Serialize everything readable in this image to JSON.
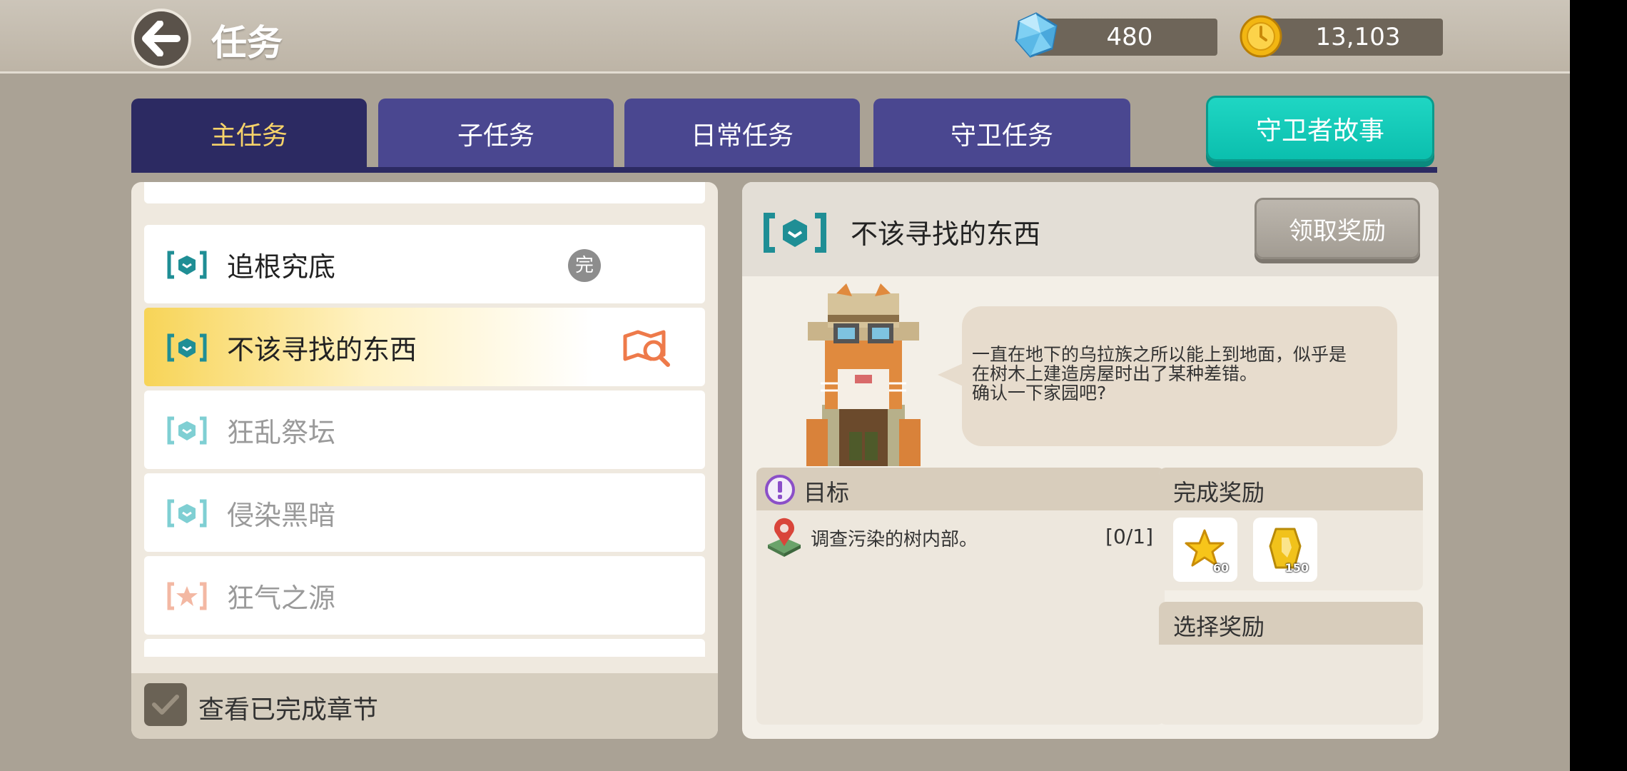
{
  "header": {
    "title": "任务",
    "gems": "480",
    "coins": "13,103"
  },
  "tabs": [
    {
      "label": "主任务",
      "active": true
    },
    {
      "label": "子任务",
      "active": false
    },
    {
      "label": "日常任务",
      "active": false
    },
    {
      "label": "守卫任务",
      "active": false
    }
  ],
  "story_button": "守卫者故事",
  "quest_list": [
    {
      "label": "追根究底",
      "badge": "完",
      "icon": "shield-bracket-icon"
    },
    {
      "label": "不该寻找的东西",
      "icon": "shield-bracket-icon",
      "selected": true
    },
    {
      "label": "狂乱祭坛",
      "icon": "shield-bracket-icon"
    },
    {
      "label": "侵染黑暗",
      "icon": "shield-bracket-icon"
    },
    {
      "label": "狂气之源",
      "icon": "star-bracket-icon"
    }
  ],
  "left_footer": {
    "checkbox_label": "查看已完成章节",
    "checked": true
  },
  "detail": {
    "title": "不该寻找的东西",
    "claim_button": "领取奖励",
    "dialogue": "一直在地下的乌拉族之所以能上到地面，似乎是\n在树木上建造房屋时出了某种差错。\n确认一下家园吧?",
    "objective_header": "目标",
    "objective_text": "调查污染的树内部。",
    "objective_count": "[0/1]",
    "complete_reward_header": "完成奖励",
    "rewards": [
      {
        "icon": "star-exp-icon",
        "qty": "60"
      },
      {
        "icon": "gold-token-icon",
        "qty": "150"
      }
    ],
    "select_reward_header": "选择奖励"
  },
  "colors": {
    "tab": "#4a4790",
    "tab_active": "#2c2a62",
    "tab_active_text": "#f6d36a",
    "accent_teal": "#0bbfae",
    "icon_teal": "#1f8e95"
  }
}
